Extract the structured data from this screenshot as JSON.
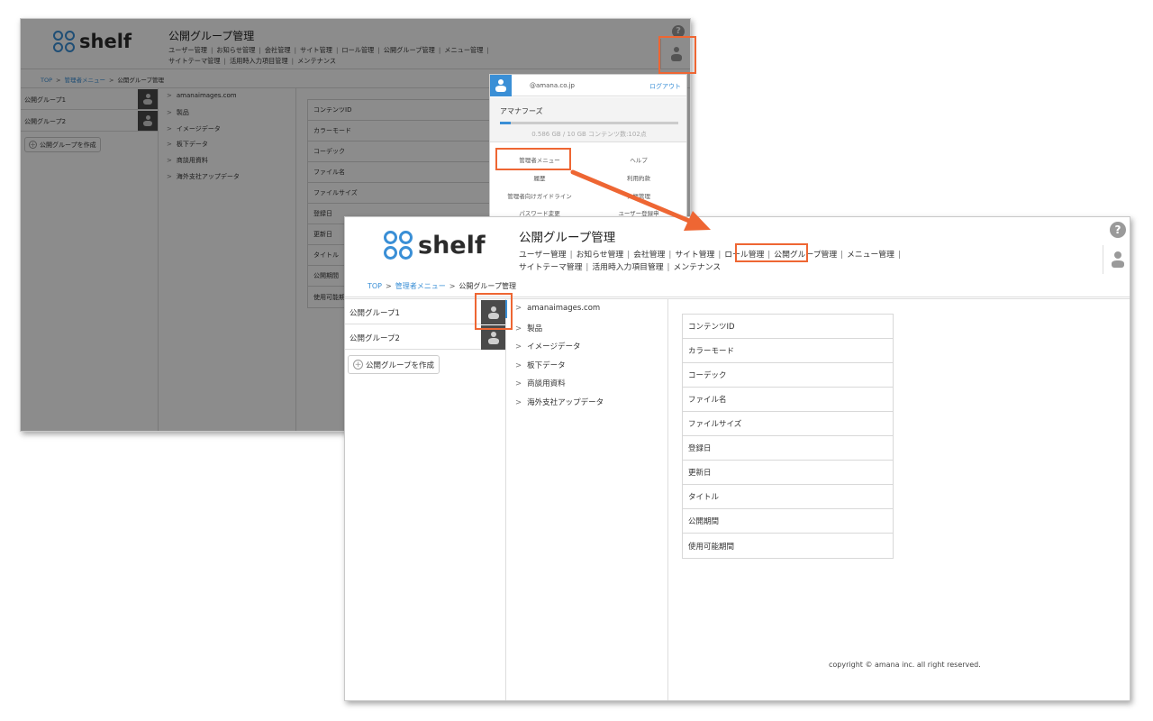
{
  "app": {
    "logo_text": "shelf",
    "page_title": "公開グループ管理",
    "help_icon_glyph": "?",
    "accent_color": "#3a8fd6",
    "highlight_color": "#ee6633"
  },
  "nav": {
    "row1": [
      "ユーザー管理",
      "お知らせ管理",
      "会社管理",
      "サイト管理",
      "ロール管理",
      "公開グループ管理",
      "メニュー管理"
    ],
    "row2": [
      "サイトテーマ管理",
      "活用時入力項目管理",
      "メンテナンス"
    ],
    "separator": "|"
  },
  "breadcrumb": {
    "items": [
      "TOP",
      "管理者メニュー",
      "公開グループ管理"
    ],
    "separator": ">"
  },
  "groups": [
    {
      "label": "公開グループ1"
    },
    {
      "label": "公開グループ2"
    }
  ],
  "create_group_label": "公開グループを作成",
  "create_group_icon": "+",
  "tree": {
    "chevron": ">",
    "items": [
      "amanaimages.com",
      "製品",
      "イメージデータ",
      "板下データ",
      "商談用資料",
      "海外支社アップデータ"
    ]
  },
  "properties": [
    "コンテンツID",
    "カラーモード",
    "コーデック",
    "ファイル名",
    "ファイルサイズ",
    "登録日",
    "更新日",
    "タイトル",
    "公開期間",
    "使用可能期間"
  ],
  "footer": {
    "copyright": "copyright © amana inc. all right reserved."
  },
  "user_menu": {
    "email": "@amana.co.jp",
    "logout": "ログアウト",
    "org_name": "アマナフーズ",
    "usage_fraction": 0.06,
    "usage_text": "0.586 GB / 10 GB  コンテンツ数:102点",
    "items": [
      "管理者メニュー",
      "ヘルプ",
      "履歴",
      "利用約款",
      "管理者向けガイドライン",
      "ス帳管理",
      "パスワード変更",
      "ユーザー登録申"
    ]
  },
  "icons": {
    "help": "help-icon",
    "user": "user-icon",
    "arrow": "arrow-icon"
  }
}
